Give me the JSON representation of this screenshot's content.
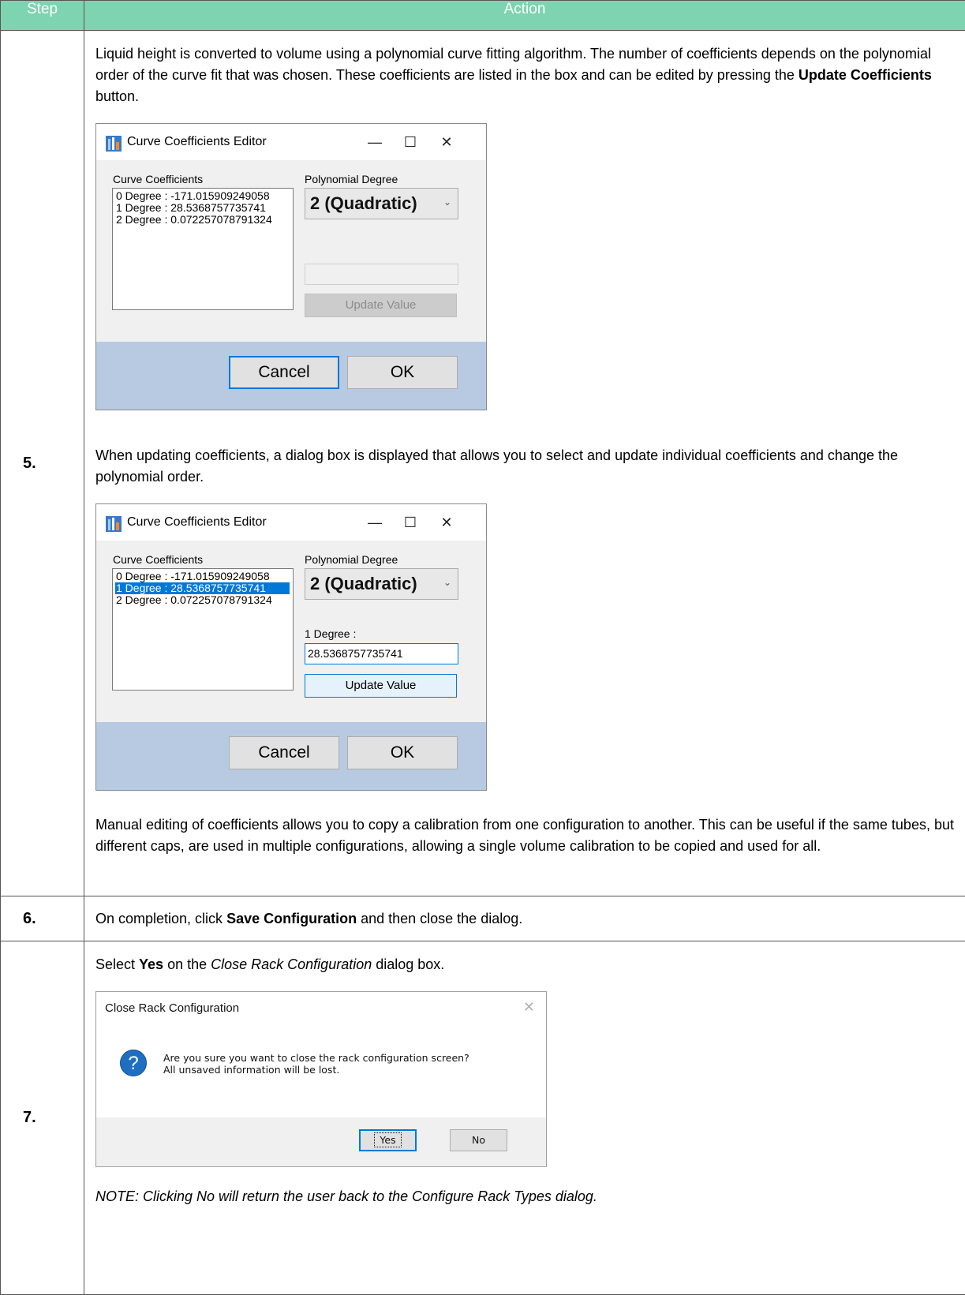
{
  "header": {
    "step": "Step",
    "action": "Action"
  },
  "rows": [
    {
      "step": "5.",
      "para1_a": "Liquid height is converted to volume using a polynomial curve fitting algorithm. The number of coefficients depends on the polynomial order of the curve fit that was chosen. These coefficients are listed in the box and can be edited by pressing the ",
      "para1_bold": "Update Coefficients",
      "para1_b": " button.",
      "para2": "When updating coefficients, a dialog box is displayed that allows you to select and update individual coefficients and change the polynomial order.",
      "para3": "Manual editing of coefficients allows you to copy a calibration from one configuration to another. This can be useful if the same tubes, but different caps, are used in multiple configurations, allowing a single volume calibration to be copied and used for all."
    },
    {
      "step": "6.",
      "text_a": "On completion, click ",
      "text_bold": "Save Configuration",
      "text_b": " and then close the dialog."
    },
    {
      "step": "7.",
      "text_a": "Select ",
      "text_bold": "Yes",
      "text_mid": " on the ",
      "text_italic": "Close Rack Configuration",
      "text_b": " dialog box.",
      "note": "NOTE: Clicking No will return the user back to the Configure Rack Types dialog."
    }
  ],
  "editor": {
    "title": "Curve Coefficients Editor",
    "minimize": "—",
    "maximize": "☐",
    "close": "✕",
    "coeff_label": "Curve Coefficients",
    "degree_label": "Polynomial Degree",
    "coefficients": [
      "0 Degree : -171.015909249058",
      "1 Degree : 28.5368757735741",
      "2 Degree : 0.072257078791324"
    ],
    "degree_value": "2 (Quadratic)",
    "update_value": "Update Value",
    "selected_label": "1 Degree :",
    "selected_value": "28.5368757735741",
    "cancel": "Cancel",
    "ok": "OK"
  },
  "close_dialog": {
    "title": "Close Rack Configuration",
    "close": "✕",
    "icon": "?",
    "message_line1": "Are you sure you want to close the rack configuration screen?",
    "message_line2": "All unsaved information will be lost.",
    "yes": "Yes",
    "no": "No"
  },
  "colors": {
    "header_bg": "#7ed3b0",
    "dialog_footer": "#b8c9e2",
    "selection": "#0078d7"
  }
}
